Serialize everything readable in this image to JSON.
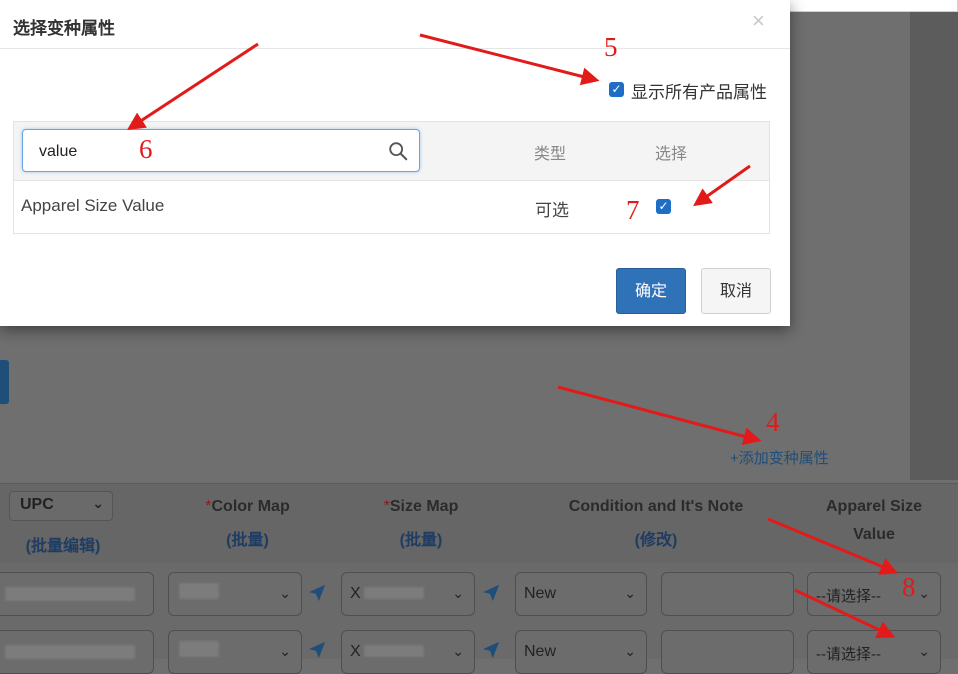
{
  "modal": {
    "title": "选择变种属性",
    "close": "×",
    "show_all_label": "显示所有产品属性",
    "show_all_checked": true,
    "search_value": "value",
    "col_type": "类型",
    "col_select": "选择",
    "rows": [
      {
        "name": "Apparel Size Value",
        "type": "可选",
        "selected": true
      }
    ],
    "ok_label": "确定",
    "cancel_label": "取消"
  },
  "page": {
    "add_variant_link": "+添加变种属性",
    "columns": {
      "upc": "UPC",
      "upc_bulk": "(批量编辑)",
      "color_map_req": "*",
      "color_map": "Color Map",
      "color_map_bulk": "(批量)",
      "size_map_req": "*",
      "size_map": "Size Map",
      "size_map_bulk": "(批量)",
      "condition": "Condition and It's Note",
      "condition_edit": "(修改)",
      "apparel_size_1": "Apparel Size",
      "apparel_size_2": "Value"
    },
    "rows": [
      {
        "condition": "New",
        "apparel_size": "--请选择--",
        "size_prefix": "X"
      },
      {
        "condition": "New",
        "apparel_size": "--请选择--",
        "size_prefix": "X"
      }
    ]
  },
  "annotations": [
    "4",
    "5",
    "6",
    "7",
    "8"
  ],
  "colors": {
    "accent": "#2f72b8",
    "arrow": "#e21a1a",
    "link": "#1f4e7a"
  }
}
